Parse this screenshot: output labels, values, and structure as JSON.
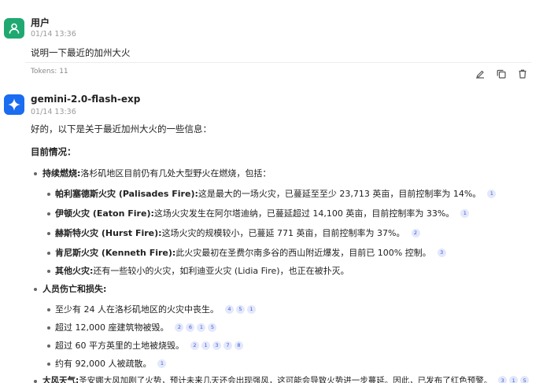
{
  "user_message": {
    "author": "用户",
    "time": "01/14 13:36",
    "text": "说明一下最近的加州大火",
    "tokens": "Tokens: 11"
  },
  "bot_message": {
    "author": "gemini-2.0-flash-exp",
    "time": "01/14 13:36",
    "intro": "好的，以下是关于最近加州大火的一些信息：",
    "section_title": "目前情况：",
    "ongoing": {
      "label": "持续燃烧:",
      "text": " 洛杉矶地区目前仍有几处大型野火在燃烧，包括：",
      "fires": [
        {
          "label": "帕利塞德斯火灾 (Palisades Fire):",
          "text": " 这是最大的一场火灾，已蔓延至至少 23,713 英亩，目前控制率为 14%。",
          "cites": [
            "1"
          ]
        },
        {
          "label": "伊顿火灾 (Eaton Fire):",
          "text": " 这场火灾发生在阿尔塔迪纳，已蔓延超过 14,100 英亩，目前控制率为 33%。",
          "cites": [
            "1"
          ]
        },
        {
          "label": "赫斯特火灾 (Hurst Fire):",
          "text": " 这场火灾的规模较小，已蔓延 771 英亩，目前控制率为 37%。",
          "cites": [
            "2"
          ]
        },
        {
          "label": "肯尼斯火灾 (Kenneth Fire):",
          "text": " 此火灾最初在圣费尔南多谷的西山附近爆发，目前已 100% 控制。",
          "cites": [
            "3"
          ]
        },
        {
          "label": "其他火灾:",
          "text": " 还有一些较小的火灾，如利迪亚火灾 (Lidia Fire)，也正在被扑灭。",
          "cites": []
        }
      ]
    },
    "casualties": {
      "label": "人员伤亡和损失:",
      "items": [
        {
          "text": "至少有 24 人在洛杉矶地区的火灾中丧生。",
          "cites": [
            "4",
            "5",
            "1"
          ]
        },
        {
          "text": "超过 12,000 座建筑物被毁。",
          "cites": [
            "2",
            "6",
            "1",
            "5"
          ]
        },
        {
          "text": "超过 60 平方英里的土地被烧毁。",
          "cites": [
            "2",
            "1",
            "3",
            "7",
            "8"
          ]
        },
        {
          "text": "约有 92,000 人被疏散。",
          "cites": [
            "1"
          ]
        }
      ]
    },
    "wind": {
      "label": "大风天气:",
      "text": " 圣安娜大风加剧了火势，预计未来几天还会出现强风，这可能会导致火势进一步蔓延。因此，已发布了红色预警。",
      "cites": [
        "3",
        "1",
        "5"
      ]
    }
  },
  "icons": {
    "edit": "edit-icon",
    "copy": "copy-icon",
    "delete": "trash-icon"
  }
}
